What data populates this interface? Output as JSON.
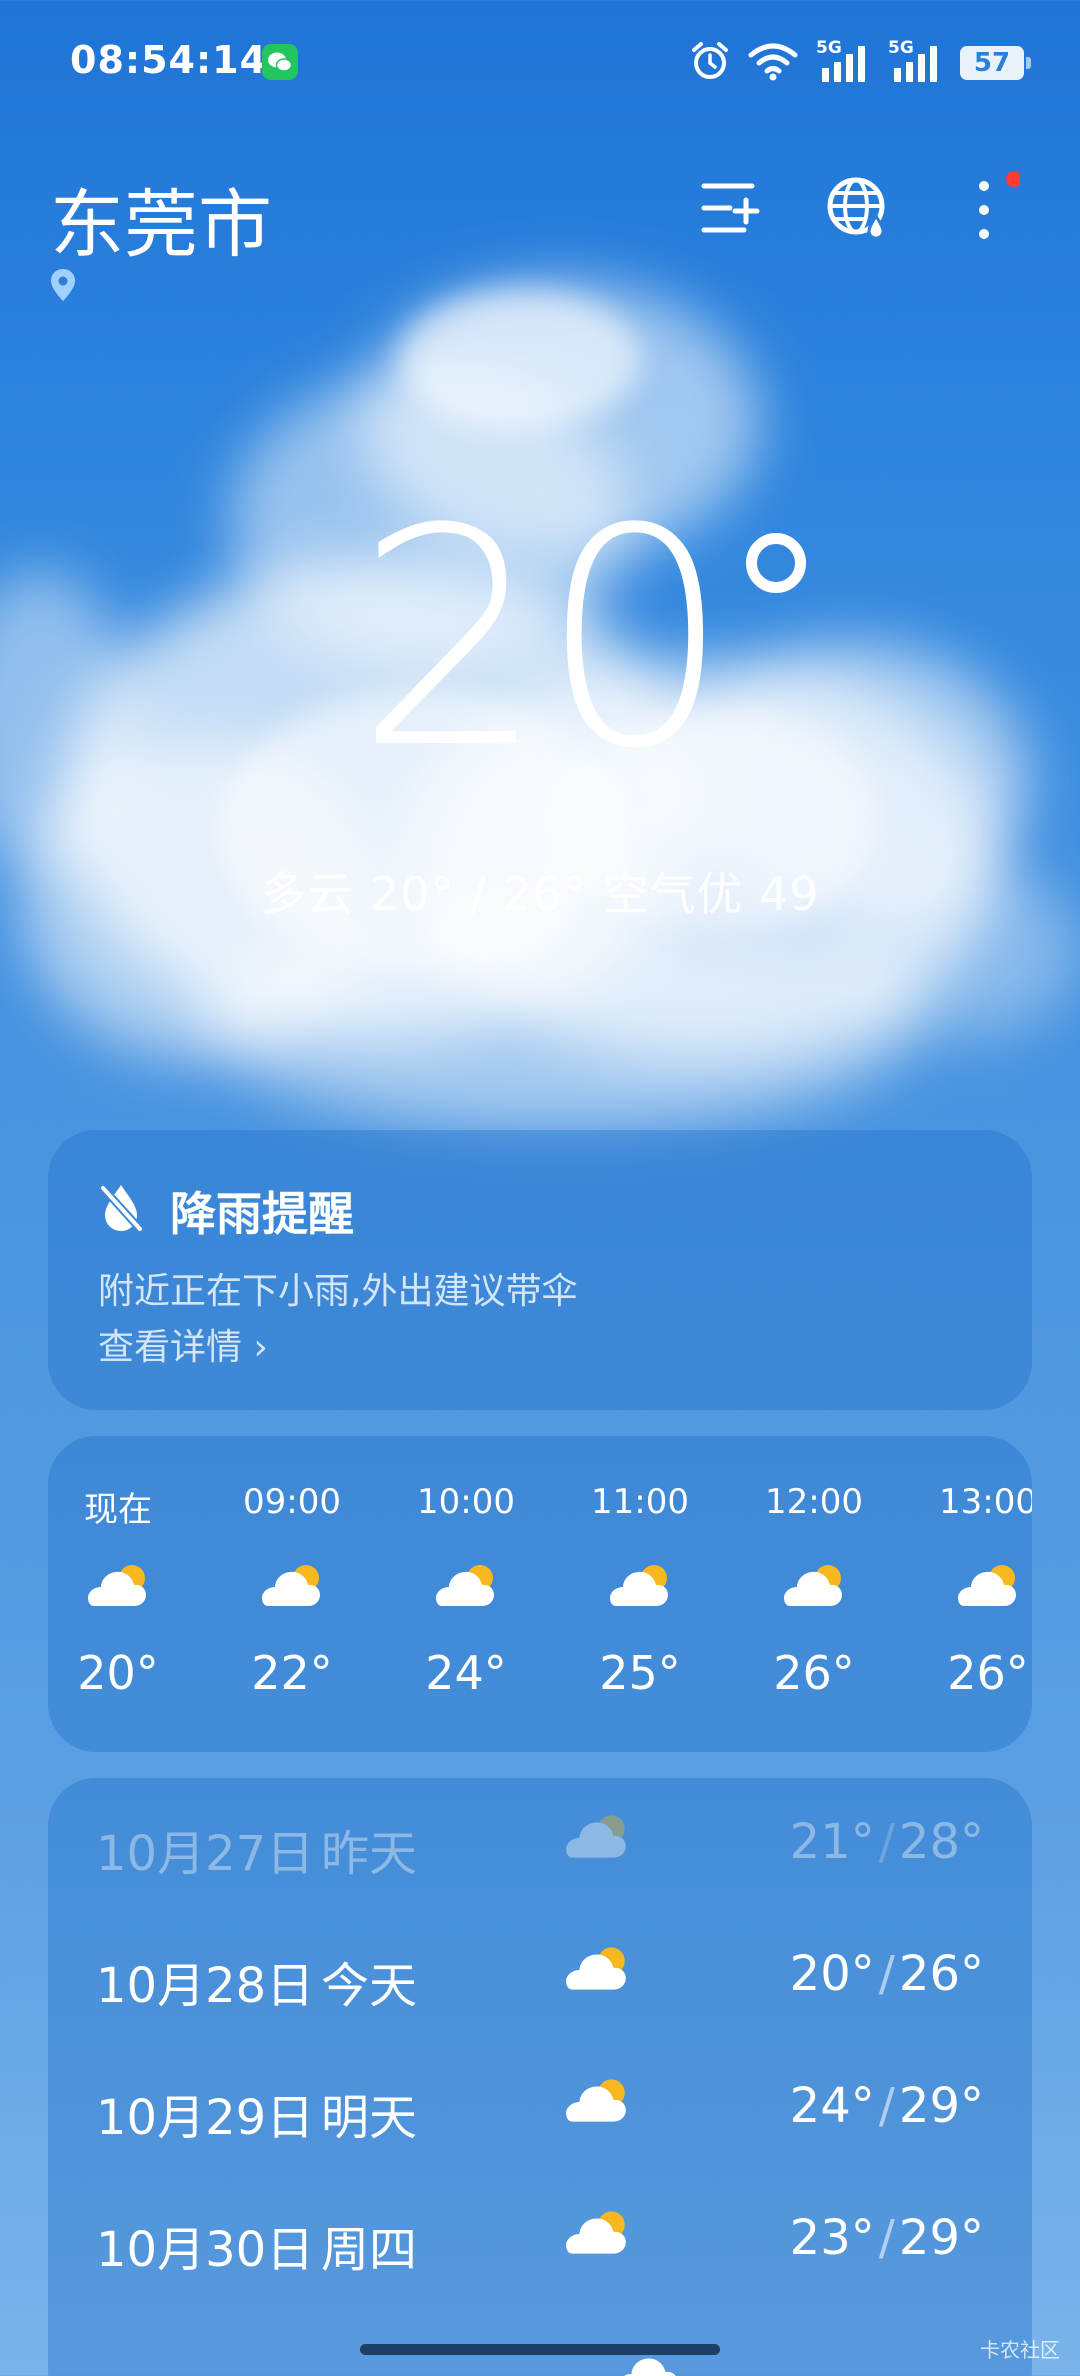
{
  "status_bar": {
    "time": "08:54:14",
    "signal_label_1": "5G",
    "signal_label_2": "5G",
    "battery": "57",
    "icons": [
      "wechat-icon",
      "alarm-icon",
      "wifi-icon",
      "signal-5g-icon",
      "signal-5g-icon",
      "battery-icon"
    ]
  },
  "header": {
    "city": "东莞市",
    "actions": [
      "city-manage-icon",
      "globe-rain-icon",
      "more-icon"
    ],
    "more_badge_color": "#ff3b30"
  },
  "current": {
    "temperature": "20",
    "summary": "多云  20° / 26°  空气优 49"
  },
  "rain_alert": {
    "title": "降雨提醒",
    "description": "附近正在下小雨,外出建议带伞",
    "link": "查看详情 ›"
  },
  "hourly": [
    {
      "time": "现在",
      "temp": "20°",
      "icon": "partly-cloudy-icon"
    },
    {
      "time": "09:00",
      "temp": "22°",
      "icon": "partly-cloudy-icon"
    },
    {
      "time": "10:00",
      "temp": "24°",
      "icon": "partly-cloudy-icon"
    },
    {
      "time": "11:00",
      "temp": "25°",
      "icon": "partly-cloudy-icon"
    },
    {
      "time": "12:00",
      "temp": "26°",
      "icon": "partly-cloudy-icon"
    },
    {
      "time": "13:00",
      "temp": "26°",
      "icon": "partly-cloudy-icon"
    }
  ],
  "daily": [
    {
      "date": "10月27日",
      "day": "昨天",
      "low": "21°",
      "high": "28°",
      "past": true,
      "icon": "partly-cloudy-icon"
    },
    {
      "date": "10月28日",
      "day": "今天",
      "low": "20°",
      "high": "26°",
      "past": false,
      "icon": "partly-cloudy-icon"
    },
    {
      "date": "10月29日",
      "day": "明天",
      "low": "24°",
      "high": "29°",
      "past": false,
      "icon": "partly-cloudy-icon"
    },
    {
      "date": "10月30日",
      "day": "周四",
      "low": "23°",
      "high": "29°",
      "past": false,
      "icon": "partly-cloudy-icon"
    }
  ],
  "watermark": "卡农社区",
  "colors": {
    "sky_top": "#1f74d6",
    "sky_bottom": "#7ab4ea",
    "sun": "#f6b81e",
    "wechat": "#23c55e"
  }
}
